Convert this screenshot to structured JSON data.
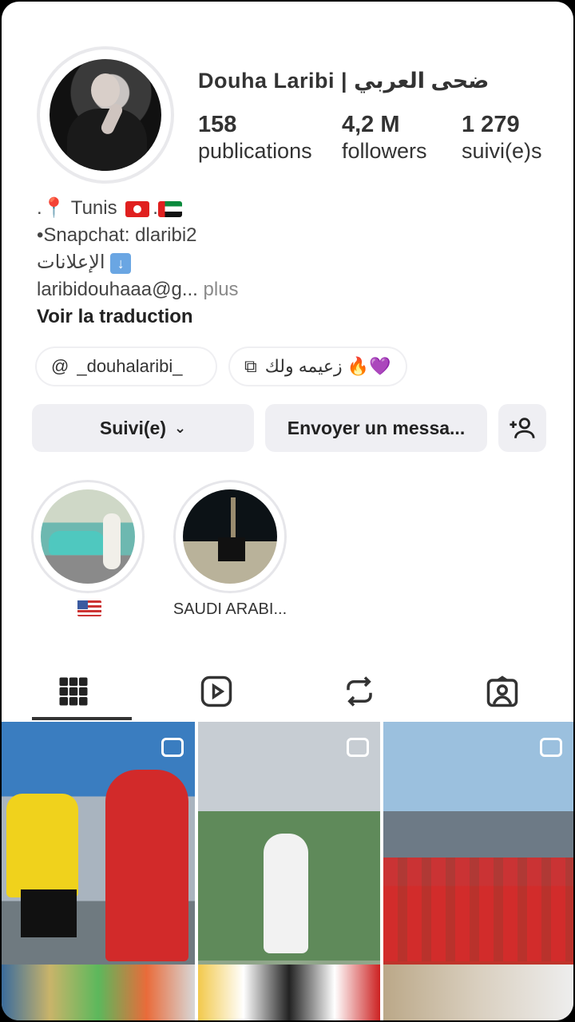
{
  "profile": {
    "username": "Douha Laribi | ضحى العربي",
    "stats": [
      {
        "value": "158",
        "label": "publications"
      },
      {
        "value": "4,2 M",
        "label": "followers"
      },
      {
        "value": "1 279",
        "label": "suivi(e)s"
      }
    ]
  },
  "bio": {
    "location": "Tunis",
    "snapchat": "•Snapchat: dlaribi2",
    "ads": "الإعلانات",
    "email": "laribidouhaaa@g...",
    "more": "plus",
    "translate": "Voir la traduction"
  },
  "links": {
    "threads": "_douhalaribi_",
    "secondary": "زعيمه ولك 🔥💜"
  },
  "actions": {
    "follow": "Suivi(e)",
    "message": "Envoyer un messa...",
    "add_user_icon": "person-add-icon"
  },
  "highlights": [
    {
      "label": "🇺🇸"
    },
    {
      "label": "SAUDI ARABI..."
    }
  ],
  "tabs": [
    "grid-icon",
    "reels-icon",
    "reposts-icon",
    "tagged-icon"
  ],
  "active_tab": 0
}
